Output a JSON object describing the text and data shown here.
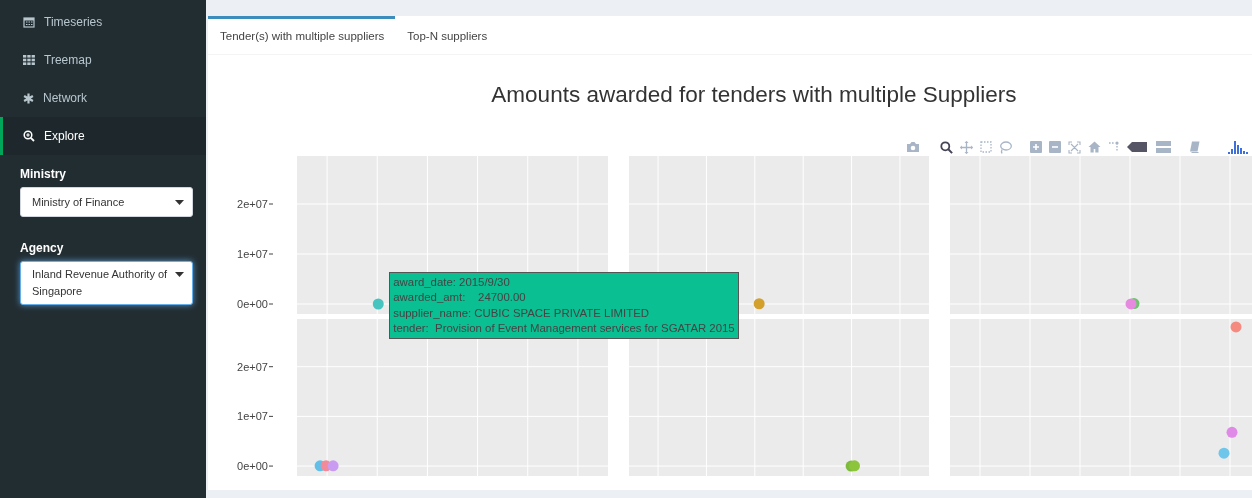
{
  "sidebar": {
    "items": [
      {
        "label": "Timeseries",
        "selected": false
      },
      {
        "label": "Treemap",
        "selected": false
      },
      {
        "label": "Network",
        "selected": false
      },
      {
        "label": "Explore",
        "selected": true
      }
    ],
    "filters": [
      {
        "label": "Ministry",
        "value": "Ministry of Finance",
        "focused": false
      },
      {
        "label": "Agency",
        "value": "Inland Revenue Authority of Singapore",
        "focused": true
      }
    ]
  },
  "tabs": [
    {
      "label": "Tender(s) with multiple suppliers",
      "selected": true
    },
    {
      "label": "Top-N suppliers",
      "selected": false
    }
  ],
  "plot": {
    "title": "Amounts awarded for tenders with multiple Suppliers",
    "rows": [
      {
        "yticks": [
          "2e+07",
          "1e+07",
          "0e+00"
        ],
        "facets": [
          {
            "points": [
              {
                "color": "#45c4c0"
              }
            ],
            "tooltip": {
              "color": "#0abf92",
              "lines": [
                "award_date: 2015/9/30",
                "awarded_amt:    24700.00",
                "supplier_name: CUBIC SPACE PRIVATE LIMITED",
                "tender:  Provision of Event Management services for SGATAR 2015"
              ]
            }
          },
          {
            "points": [
              {
                "color": "#d4a02c"
              }
            ]
          },
          {
            "points": [
              {
                "color": "#6cc46c"
              },
              {
                "color": "#e68ae0"
              }
            ]
          }
        ]
      },
      {
        "yticks": [
          "2e+07",
          "1e+07",
          "0e+00"
        ],
        "facets": [
          {
            "points": [
              {
                "color": "#62bfe8"
              },
              {
                "color": "#f28a9a"
              },
              {
                "color": "#c99cf2"
              }
            ]
          },
          {
            "points": [
              {
                "color": "#7dbb3c"
              },
              {
                "color": "#8cc43c"
              }
            ]
          },
          {
            "points": [
              {
                "color": "#f58a80"
              },
              {
                "color": "#e08ae8"
              },
              {
                "color": "#6ec6ea"
              }
            ]
          }
        ]
      }
    ]
  }
}
